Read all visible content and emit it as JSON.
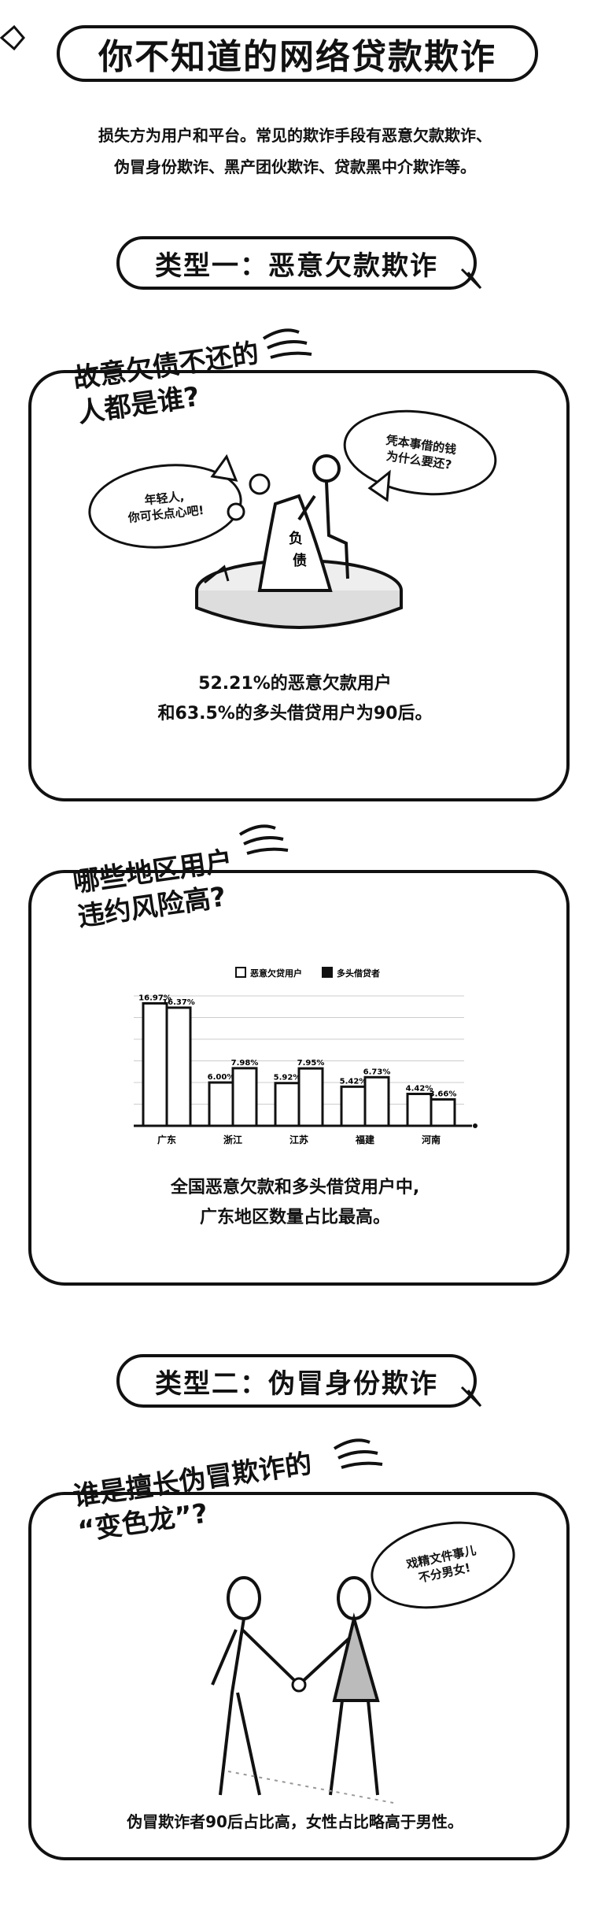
{
  "title": "你不知道的网络贷款欺诈",
  "intro": {
    "line1": "损失方为用户和平台。常见的欺诈手段有恶意欠款欺诈、",
    "line2": "伪冒身份欺诈、黑产团伙欺诈、贷款黑中介欺诈等。"
  },
  "section1": {
    "banner": "类型一：恶意欠款欺诈",
    "panel1": {
      "q_line1": "故意欠债不还的",
      "q_line2": "人都是谁?",
      "bubble_left_l1": "年轻人,",
      "bubble_left_l2": "你可长点心吧!",
      "bubble_right_l1": "凭本事借的钱",
      "bubble_right_l2": "为什么要还?",
      "debt_label": "负债",
      "stat_l1": "52.21%的恶意欠款用户",
      "stat_l2": "和63.5%的多头借贷用户为90后。"
    },
    "panel2": {
      "q_line1": "哪些地区用户",
      "q_line2": "违约风险高?",
      "stat_l1": "全国恶意欠款和多头借贷用户中,",
      "stat_l2": "广东地区数量占比最高。"
    }
  },
  "chart_data": {
    "type": "bar",
    "categories": [
      "广东",
      "浙江",
      "江苏",
      "福建",
      "河南"
    ],
    "series": [
      {
        "name": "恶意欠贷用户",
        "values": [
          16.97,
          6.0,
          5.92,
          5.42,
          4.42
        ],
        "labels": [
          "16.97%",
          "6.00%",
          "5.92%",
          "5.42%",
          "4.42%"
        ]
      },
      {
        "name": "多头借贷者",
        "values": [
          16.37,
          7.98,
          7.95,
          6.73,
          3.66
        ],
        "labels": [
          "16.37%",
          "7.98%",
          "7.95%",
          "6.73%",
          "3.66%"
        ]
      }
    ],
    "legend": "top",
    "ylim": [
      0,
      18
    ],
    "grid": true
  },
  "section2": {
    "banner": "类型二：伪冒身份欺诈",
    "panel3": {
      "q_line1": "谁是擅长伪冒欺诈的",
      "q_line2": "“变色龙”?",
      "bubble_l1": "戏精文件事儿",
      "bubble_l2": "不分男女!",
      "stat": "伪冒欺诈者90后占比高，女性占比略高于男性。"
    }
  },
  "colors": {
    "ink": "#111111",
    "paper": "#ffffff",
    "gray": "#bbbbbb"
  }
}
